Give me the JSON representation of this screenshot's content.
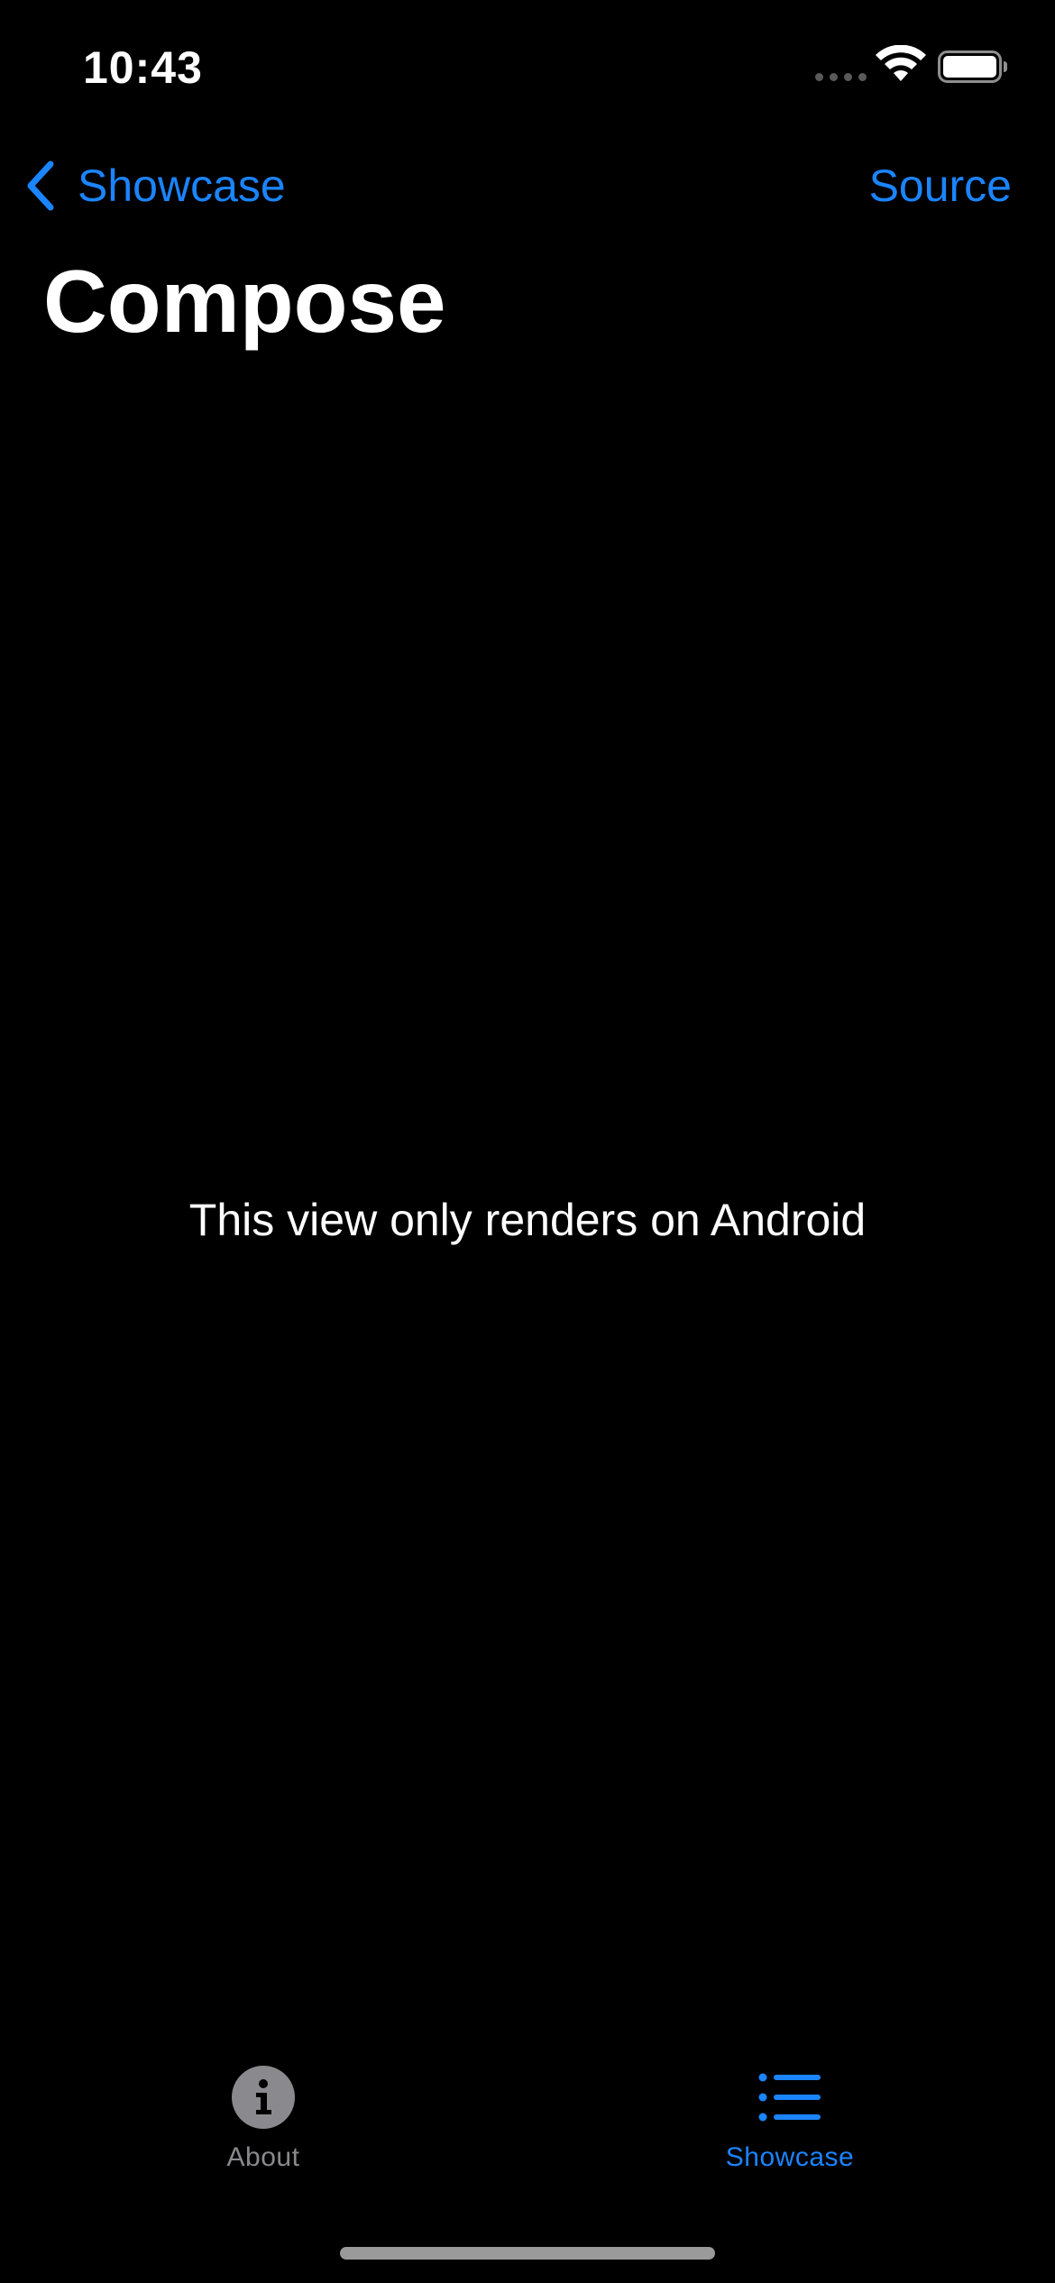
{
  "status_bar": {
    "time": "10:43"
  },
  "nav": {
    "back_label": "Showcase",
    "trailing_label": "Source"
  },
  "page": {
    "title": "Compose",
    "message": "This view only renders on Android"
  },
  "tab_bar": {
    "tabs": [
      {
        "label": "About",
        "icon": "info-circle-icon",
        "selected": false
      },
      {
        "label": "Showcase",
        "icon": "list-bullet-icon",
        "selected": true
      }
    ]
  },
  "colors": {
    "background": "#000000",
    "accent": "#1b84ff",
    "text": "#ffffff",
    "inactive_tab": "#8a8a8e"
  }
}
